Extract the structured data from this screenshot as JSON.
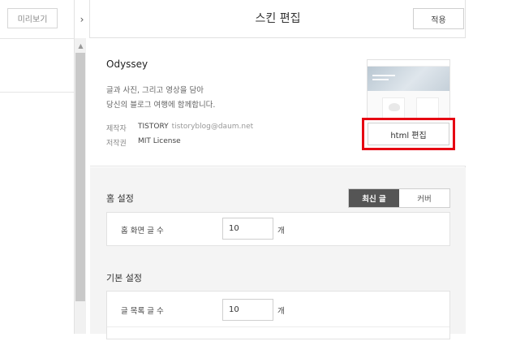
{
  "left_panel": {
    "preview_label": "미리보기",
    "toggle_icon": "›",
    "scroll_up_icon": "▲"
  },
  "editor": {
    "title": "스킨 편집",
    "apply_label": "적용"
  },
  "skin": {
    "name": "Odyssey",
    "description_line1": "글과 사진, 그리고 영상을 담아",
    "description_line2": "당신의 블로그 여행에 함께합니다.",
    "author_label": "제작자",
    "author_name": "TISTORY",
    "author_email": "tistoryblog@daum.net",
    "license_label": "저작권",
    "license_value": "MIT License",
    "html_edit_label": "html 편집"
  },
  "home_settings": {
    "title": "홈 설정",
    "tabs": [
      {
        "label": "최신 글",
        "active": true
      },
      {
        "label": "커버",
        "active": false
      }
    ],
    "post_count_label": "홈 화면 글 수",
    "post_count_value": "10",
    "post_count_unit": "개"
  },
  "basic_settings": {
    "title": "기본 설정",
    "list_count_label": "글 목록 글 수",
    "list_count_value": "10",
    "list_count_unit": "개"
  },
  "colors": {
    "highlight_border": "#e60012",
    "active_tab_bg": "#555555"
  }
}
